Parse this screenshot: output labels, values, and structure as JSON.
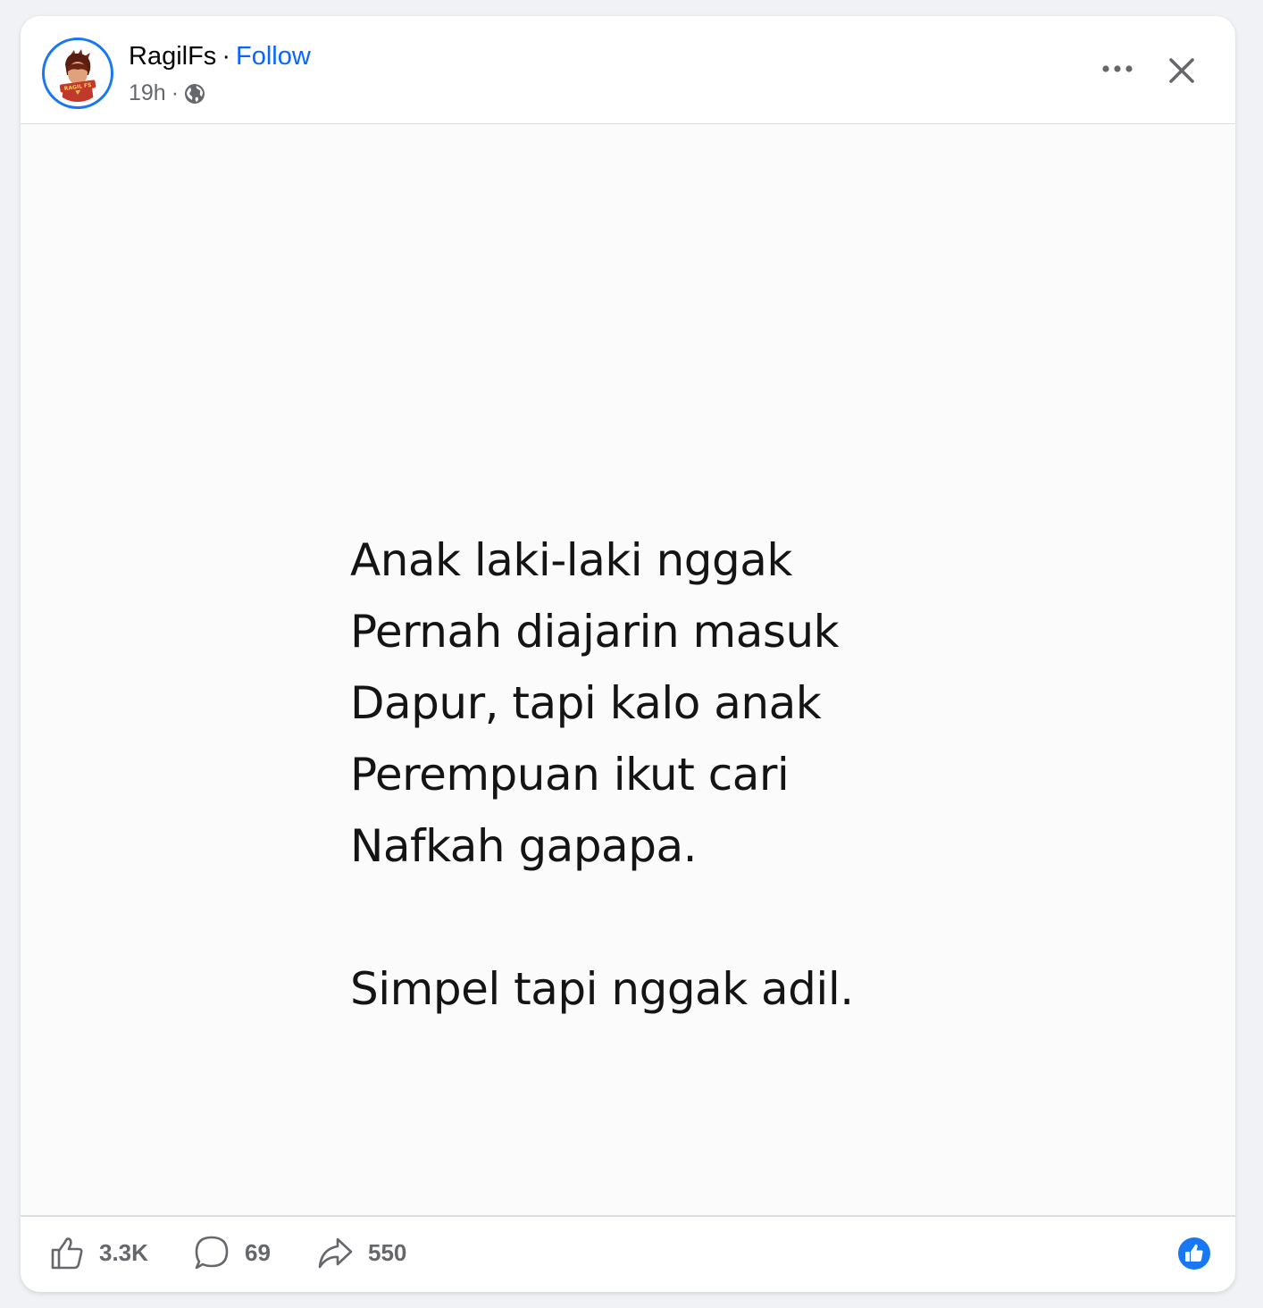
{
  "post": {
    "author": "RagilFs",
    "separator": "·",
    "follow_label": "Follow",
    "time": "19h",
    "meta_separator": "·",
    "privacy_icon": "globe-icon",
    "avatar_text": "RAGIL FS"
  },
  "image_text": {
    "lines": [
      "Anak laki-laki nggak",
      "Pernah diajarin masuk",
      "Dapur, tapi kalo anak",
      "Perempuan ikut cari",
      "Nafkah gapapa."
    ],
    "closing": "Simpel tapi nggak adil."
  },
  "footer": {
    "likes": "3.3K",
    "comments": "69",
    "shares": "550"
  },
  "colors": {
    "accent": "#1877f2",
    "follow": "#0866ff",
    "muted": "#65676b",
    "text": "#050505"
  }
}
